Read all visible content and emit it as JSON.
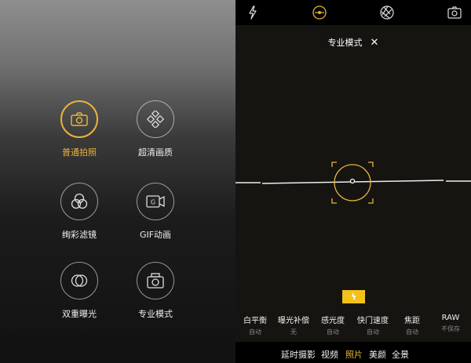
{
  "modes_panel": {
    "items": [
      {
        "label": "普通拍照",
        "icon": "camera-icon",
        "active": true
      },
      {
        "label": "超清画质",
        "icon": "diamond-grid-icon",
        "active": false
      },
      {
        "label": "绚彩滤镜",
        "icon": "color-filter-icon",
        "active": false
      },
      {
        "label": "GIF动画",
        "icon": "gif-camera-icon",
        "active": false
      },
      {
        "label": "双重曝光",
        "icon": "double-exposure-icon",
        "active": false
      },
      {
        "label": "专业模式",
        "icon": "pro-camera-icon",
        "active": false
      }
    ]
  },
  "viewfinder": {
    "top_icons": [
      "flash-icon",
      "pro-mode-icon",
      "aperture-icon",
      "switch-camera-icon"
    ],
    "title": "专业模式",
    "close_label": "✕",
    "flash_indicator": "ϟ",
    "params": [
      {
        "name": "白平衡",
        "value": "自动"
      },
      {
        "name": "曝光补偿",
        "value": "无"
      },
      {
        "name": "感光度",
        "value": "自动"
      },
      {
        "name": "快门速度",
        "value": "自动"
      },
      {
        "name": "焦距",
        "value": "自动"
      },
      {
        "name": "RAW",
        "value": "不保存"
      }
    ],
    "capture_modes": [
      "延时摄影",
      "视频",
      "照片",
      "美颜",
      "全景"
    ],
    "active_capture_mode": "照片"
  },
  "colors": {
    "accent": "#e8b339",
    "flash_yellow": "#f3c21a"
  }
}
